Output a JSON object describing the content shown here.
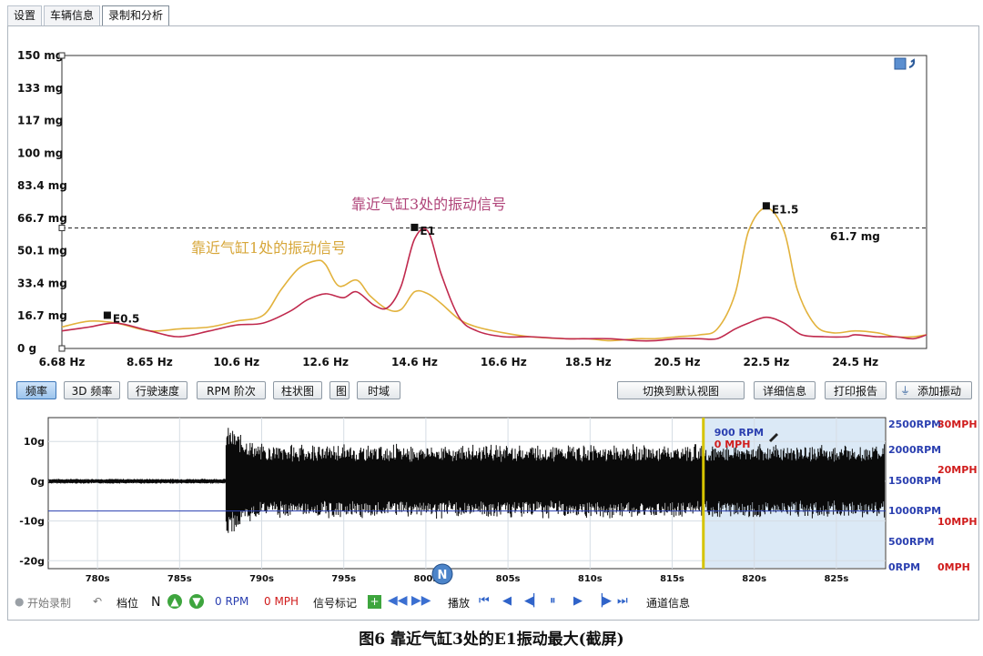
{
  "tabs": [
    "设置",
    "车辆信息",
    "录制和分析"
  ],
  "main_chart": {
    "y_ticks": [
      "150 mg",
      "133 mg",
      "117 mg",
      "100 mg",
      "83.4 mg",
      "66.7 mg",
      "50.1 mg",
      "33.4 mg",
      "16.7 mg",
      "0 g"
    ],
    "x_ticks": [
      "6.68 Hz",
      "8.65 Hz",
      "10.6 Hz",
      "12.6 Hz",
      "14.6 Hz",
      "16.6 Hz",
      "18.5 Hz",
      "20.5 Hz",
      "22.5 Hz",
      "24.5 Hz"
    ],
    "threshold_label": "61.7 mg",
    "annotation_cyl3": "靠近气缸3处的振动信号",
    "annotation_cyl1": "靠近气缸1处的振动信号",
    "markers": [
      {
        "label": "E0.5"
      },
      {
        "label": "E1"
      },
      {
        "label": "E1.5"
      }
    ]
  },
  "chart_data": [
    {
      "type": "line",
      "x_unit": "Hz",
      "y_unit": "mg",
      "xlim": [
        6.68,
        26.1
      ],
      "ylim": [
        0,
        150
      ],
      "threshold": 61.7,
      "series": [
        {
          "name": "靠近气缸3处的振动信号",
          "color": "#c0294d",
          "x": [
            6.68,
            7.3,
            7.9,
            8.65,
            9.3,
            10.0,
            10.6,
            11.2,
            11.8,
            12.2,
            12.6,
            13.0,
            13.3,
            13.7,
            14.0,
            14.3,
            14.6,
            14.9,
            15.2,
            15.6,
            16.0,
            16.6,
            17.2,
            18.0,
            18.5,
            19.0,
            19.6,
            20.0,
            20.5,
            21.0,
            21.4,
            21.8,
            22.1,
            22.5,
            22.9,
            23.3,
            23.8,
            24.3,
            24.5,
            25.0,
            25.4,
            25.8,
            26.1
          ],
          "y": [
            9,
            11,
            13,
            9,
            6,
            9,
            12,
            13,
            19,
            25,
            28,
            26,
            29,
            22,
            21,
            32,
            56,
            60,
            38,
            16,
            9,
            6,
            6,
            5,
            5,
            5,
            4,
            4,
            5,
            5,
            5,
            10,
            13,
            16,
            13,
            7,
            6,
            6,
            7,
            6,
            6,
            5,
            7
          ]
        },
        {
          "name": "靠近气缸1处的振动信号",
          "color": "#e2b23c",
          "x": [
            6.68,
            7.3,
            7.9,
            8.65,
            9.3,
            10.0,
            10.6,
            11.2,
            11.6,
            12.0,
            12.4,
            12.6,
            12.9,
            13.3,
            13.6,
            14.0,
            14.3,
            14.6,
            14.9,
            15.2,
            15.6,
            16.0,
            16.6,
            17.2,
            18.0,
            18.5,
            19.0,
            19.6,
            20.0,
            20.5,
            21.0,
            21.4,
            21.8,
            22.1,
            22.5,
            22.9,
            23.2,
            23.6,
            24.0,
            24.5,
            25.0,
            25.4,
            25.8,
            26.1
          ],
          "y": [
            11,
            14,
            13,
            9,
            10,
            11,
            14,
            17,
            30,
            41,
            45,
            43,
            32,
            35,
            27,
            20,
            20,
            29,
            28,
            23,
            15,
            11,
            8,
            6,
            5,
            5,
            4,
            5,
            5,
            6,
            7,
            10,
            28,
            60,
            72,
            60,
            30,
            12,
            8,
            9,
            8,
            6,
            6,
            7
          ]
        }
      ]
    },
    {
      "type": "line",
      "x_unit": "s",
      "y_unit": "g",
      "xlim": [
        777,
        828
      ],
      "ylim": [
        -22,
        16
      ],
      "x_ticks": [
        "780s",
        "785s",
        "790s",
        "795s",
        "800s",
        "805s",
        "810s",
        "815s",
        "820s",
        "825s"
      ],
      "y_ticks": [
        "10g",
        "0g",
        "-10g",
        "-20g"
      ],
      "right_axis_rpm": [
        "2500RPM",
        "2000RPM",
        "1500RPM",
        "1000RPM",
        "500RPM",
        "0RPM"
      ],
      "right_axis_mph": [
        "30MPH",
        "20MPH",
        "10MPH",
        "0MPH"
      ],
      "cursor_time": 816.9,
      "cursor_rpm": "900 RPM",
      "cursor_mph": "0 MPH",
      "marker_label": "N"
    }
  ],
  "buttons": [
    "频率",
    "3D 频率",
    "行驶速度",
    "RPM 阶次",
    "柱状图",
    "图",
    "时域",
    "切换到默认视图",
    "详细信息",
    "打印报告",
    "添加振动"
  ],
  "transport": {
    "record": "开始录制",
    "gear_label": "档位",
    "gear": "N",
    "rpm": "0 RPM",
    "mph": "0 MPH",
    "signal_mark": "信号标记",
    "play": "播放",
    "channel": "通道信息"
  },
  "caption": "图6   靠近气缸3处的E1振动最大(截屏)"
}
